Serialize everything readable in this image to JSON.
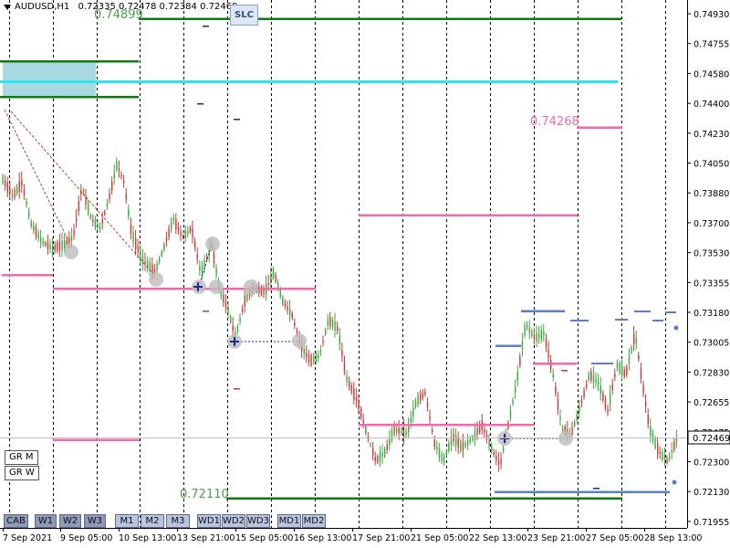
{
  "header": {
    "symbol": "AUDUSD,H1",
    "ohlc": "0.72335 0.72478 0.72384 0.72469"
  },
  "price_axis": {
    "ticks": [
      "0.74930",
      "0.74755",
      "0.74580",
      "0.74400",
      "0.74230",
      "0.74050",
      "0.73880",
      "0.73700",
      "0.73530",
      "0.73355",
      "0.73180",
      "0.73005",
      "0.72830",
      "0.72655",
      "0.72475",
      "0.72300",
      "0.72130",
      "0.71955"
    ],
    "current_price": "0.72469"
  },
  "time_axis": {
    "labels": [
      "7 Sep 2021",
      "9 Sep 05:00",
      "10 Sep 13:00",
      "13 Sep 21:00",
      "15 Sep 05:00",
      "16 Sep 13:00",
      "17 Sep 21:00",
      "21 Sep 05:00",
      "22 Sep 13:00",
      "23 Sep 21:00",
      "27 Sep 05:00",
      "28 Sep 13:00"
    ]
  },
  "level_labels": {
    "top_green": "0.74899",
    "pink": "0.74268",
    "bottom_green": "0.72110"
  },
  "slc_button": "SLC",
  "left_buttons": {
    "gr_m": "GR M",
    "gr_w": "GR W"
  },
  "period_buttons": [
    "CAB",
    "W1",
    "W2",
    "W3",
    "M1",
    "M2",
    "M3",
    "WD1",
    "WD2",
    "WD3",
    "MD1",
    "MD2"
  ],
  "colors": {
    "green": "#127a12",
    "cyan": "#2fe6ee",
    "pink": "#f06aae",
    "blue_level": "#5b7fc4",
    "bull": "#3da83d",
    "bear": "#c23a3a"
  }
}
